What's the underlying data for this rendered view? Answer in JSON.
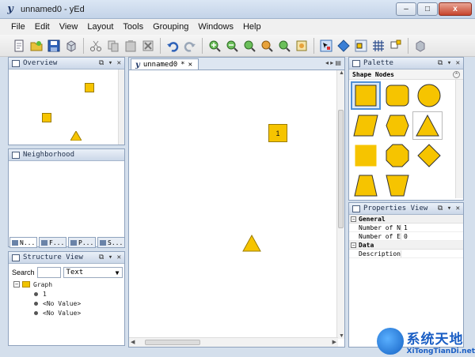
{
  "window": {
    "title": "unnamed0 - yEd",
    "app_icon": "y",
    "minimize": "–",
    "maximize": "□",
    "close": "x"
  },
  "menu": {
    "items": [
      "File",
      "Edit",
      "View",
      "Layout",
      "Tools",
      "Grouping",
      "Windows",
      "Help"
    ]
  },
  "toolbar": {
    "icons": [
      "new-document-icon",
      "open-folder-icon",
      "save-icon",
      "cube-icon",
      "cut-icon",
      "copy-icon",
      "paste-icon",
      "delete-icon",
      "undo-icon",
      "redo-icon",
      "zoom-in-icon",
      "zoom-out-icon",
      "zoom-actual-icon",
      "zoom-selection-icon",
      "zoom-fit-icon",
      "fit-content-icon",
      "edit-mode-icon",
      "navigation-icon",
      "snap-icon",
      "grid-icon",
      "properties-icon",
      "tool-icon"
    ]
  },
  "overview": {
    "title": "Overview"
  },
  "neighborhood": {
    "title": "Neighborhood"
  },
  "bottom_tabs": [
    "N...",
    "F...",
    "P...",
    "S..."
  ],
  "structure": {
    "title": "Structure View",
    "search_label": "Search",
    "search_value": "",
    "mode_value": "Text",
    "tree": {
      "root": "Graph",
      "children": [
        "1",
        "<No Value>",
        "<No Value>"
      ]
    }
  },
  "editor": {
    "tab_label": "unnamed0",
    "tab_modified": "*",
    "nodes": [
      {
        "shape": "square",
        "label": "1"
      },
      {
        "shape": "triangle",
        "label": ""
      }
    ]
  },
  "palette": {
    "title": "Palette",
    "section_label": "Shape Nodes",
    "shapes": [
      "rectangle",
      "rounded-rectangle",
      "ellipse",
      "parallelogram",
      "hexagon",
      "triangle",
      "rectangle-flat",
      "octagon",
      "diamond",
      "trapezoid",
      "trapezoid-inverted"
    ],
    "fill_color": "#f6c400",
    "selected_border": "#4f8fd6"
  },
  "properties": {
    "title": "Properties View",
    "sections": [
      {
        "name": "General",
        "rows": [
          {
            "key": "Number of N...",
            "value": "1"
          },
          {
            "key": "Number of E...",
            "value": "0"
          }
        ]
      },
      {
        "name": "Data",
        "rows": [
          {
            "key": "Description",
            "value": ""
          }
        ]
      }
    ]
  },
  "watermark": {
    "cn": "系统天地",
    "url": "XiTongTianDi.net"
  }
}
